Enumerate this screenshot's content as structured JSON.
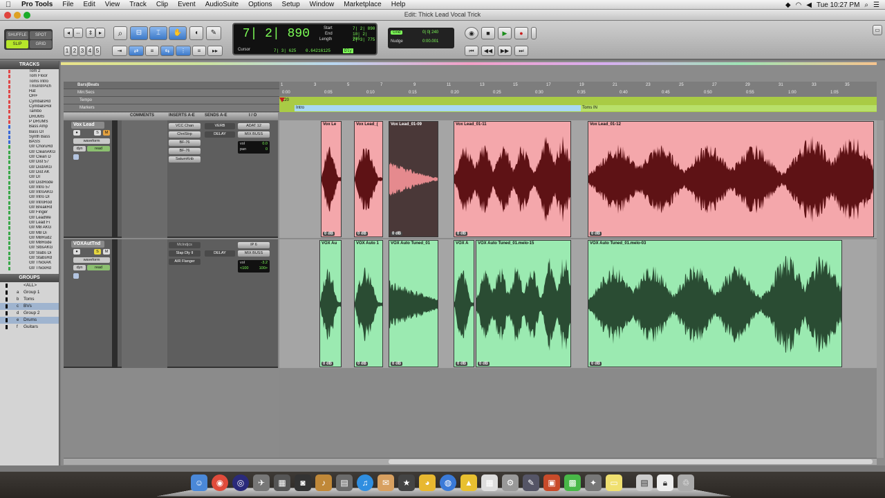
{
  "menubar": {
    "app_name": "Pro Tools",
    "items": [
      "File",
      "Edit",
      "View",
      "Track",
      "Clip",
      "Event",
      "AudioSuite",
      "Options",
      "Setup",
      "Window",
      "Marketplace",
      "Help"
    ],
    "clock": "Tue 10:27 PM"
  },
  "window": {
    "title": "Edit: Thick Lead Vocal Trick"
  },
  "toolbar": {
    "modes": {
      "shuffle": "SHUFFLE",
      "spot": "SPOT",
      "slip": "SLIP",
      "grid": "GRID"
    },
    "zoom_presets": [
      "1",
      "2",
      "3",
      "4",
      "5"
    ],
    "main_counter": "7| 2| 890",
    "start_label": "Start",
    "start_value": "7| 2| 890",
    "end_label": "End",
    "end_value": "10| 2| 705",
    "length_label": "Length",
    "length_value": "2| 3| 775",
    "cursor_label": "Cursor",
    "cursor_value": "7| 3| 625",
    "cursor_sample": "0.64216125",
    "dly": "Dly",
    "grid_label": "Grid",
    "grid_value": "0| 0| 240",
    "nudge_label": "Nudge",
    "nudge_value": "0:00.001"
  },
  "left_panel": {
    "tracks_header": "TRACKS",
    "tracks": [
      "Tom 2",
      "Tom Floor",
      "Toms Intro",
      "TmsIntrPich",
      "Hat",
      "OH+",
      "CymbalsRd",
      "CymbalsHol",
      "Tambo",
      "DRUMS",
      "P DRUMS",
      "Bass Amp",
      "Bass DI",
      "Synth Bass",
      "BASS",
      "Gtr ChoruRd",
      "Gtr CleanAKG",
      "Gtr Clean D",
      "Gtr Dist 57",
      "Gtr DistAKG",
      "Gtr Dist AK",
      "Gtr DI",
      "Gtr DistRode",
      "Gtr Intro 57",
      "Gtr IntroAKG",
      "Gtr Intro DI",
      "Gtr IntroRod",
      "Gtr BreakRd",
      "Gtr Finger",
      "Gtr LeadMe",
      "Gtr Lead Fi",
      "Gtr M8 AKG",
      "Gtr M8 Di",
      "Gtr M8Rud2",
      "Gtr M8Rode",
      "Gtr SlbsAKG",
      "Gtr Slabs Di",
      "Gtr StabsRd",
      "Gtr ThickAK",
      "Gtr ThickRd"
    ],
    "groups_header": "GROUPS",
    "groups": [
      {
        "id": "",
        "name": "<ALL>"
      },
      {
        "id": "a",
        "name": "Group 1"
      },
      {
        "id": "b",
        "name": "Toms"
      },
      {
        "id": "c",
        "name": "BVs"
      },
      {
        "id": "d",
        "name": "Group 2"
      },
      {
        "id": "e",
        "name": "Drums"
      },
      {
        "id": "f",
        "name": "Guitars"
      }
    ]
  },
  "rulers": {
    "bars_beats": "Bars|Beats",
    "min_secs": "Min:Secs",
    "tempo": "Tempo",
    "markers": "Markers",
    "tempo_value": "120",
    "bar_ticks": [
      "1",
      "3",
      "5",
      "7",
      "9",
      "11",
      "13",
      "15",
      "17",
      "19",
      "21",
      "23",
      "25",
      "27",
      "29",
      "31",
      "33",
      "35"
    ],
    "time_ticks": [
      "0:00",
      "0:05",
      "0:10",
      "0:15",
      "0:20",
      "0:25",
      "0:30",
      "0:35",
      "0:40",
      "0:45",
      "0:50",
      "0:55",
      "1:00",
      "1:05"
    ],
    "marker_intro": "Intro",
    "marker_toms": "Toms IN"
  },
  "columns": {
    "comments": "COMMENTS",
    "inserts": "INSERTS A-E",
    "sends": "SENDS A-E",
    "io": "I / O"
  },
  "tracks": [
    {
      "name": "Vox Lead",
      "view": "waveform",
      "dyn": "dyn",
      "read": "read",
      "inserts": [
        "VCC Chan",
        "ChnlStrp",
        "BF-76",
        "BF-76",
        "SaturnKnb"
      ],
      "sends": [
        "VERB",
        "DELAY"
      ],
      "input": "ADAT 12",
      "output": "MIX BUSS",
      "vol": "0.0",
      "pan": "0",
      "clips": [
        {
          "name": "Vox Le",
          "gain": "0 dB"
        },
        {
          "name": "Vox Lead_(",
          "gain": "0 dB"
        },
        {
          "name": "Vox Lead_01-09",
          "gain": "0 dB"
        },
        {
          "name": "Vox Lead_01-11",
          "gain": "0 dB"
        },
        {
          "name": "Vox Lead_01-12",
          "gain": "0 dB"
        }
      ]
    },
    {
      "name": "VOXAutTnd",
      "view": "waveform",
      "dyn": "dyn",
      "read": "read",
      "inserts": [
        "McIndjcs",
        "Slap Dly II",
        "AIR Flanger"
      ],
      "sends": [
        "DELAY"
      ],
      "input": "IP 6",
      "output": "MIX BUSS",
      "vol": "-3.2",
      "pan_l": "<100",
      "pan_r": "100>",
      "clips": [
        {
          "name": "VOX Au",
          "gain": "0 dB"
        },
        {
          "name": "VOX Auto 1",
          "gain": "0 dB"
        },
        {
          "name": "VOX Auto Tuned_01",
          "gain": "0 dB"
        },
        {
          "name": "VOX A",
          "gain": "0 dB"
        },
        {
          "name": "VOX Auto Tuned_01.melo-15",
          "gain": "0 dB"
        },
        {
          "name": "VOX Auto Tuned_01.melo-03",
          "gain": "0 dB"
        }
      ]
    }
  ],
  "colors": {
    "lead_clip": "#f4a7ab",
    "lead_wave": "#5e1215",
    "tuned_clip": "#9beab1",
    "tuned_wave": "#2a4c33",
    "accent_blue": "#3c79c8"
  }
}
